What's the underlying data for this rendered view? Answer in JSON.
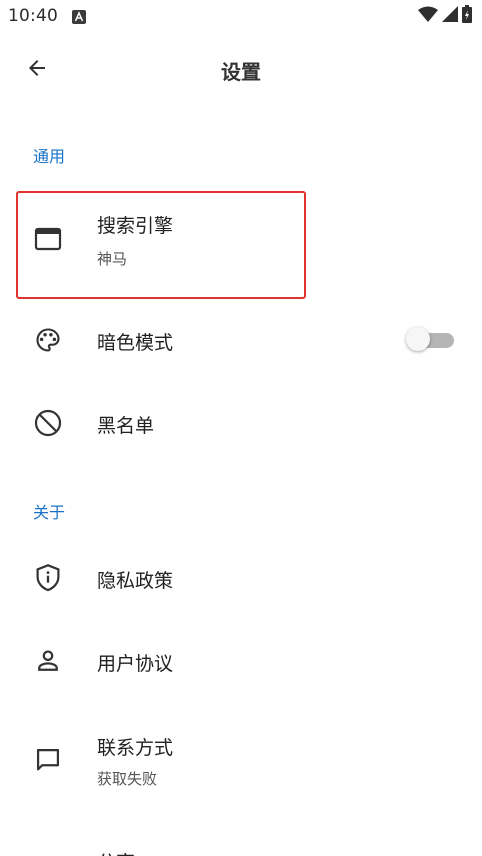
{
  "status_bar": {
    "time": "10:40",
    "icons": [
      "notification-a-icon",
      "wifi-icon",
      "signal-icon",
      "battery-icon"
    ]
  },
  "app_bar": {
    "back_icon": "arrow-back-icon",
    "title": "设置"
  },
  "sections": {
    "general": {
      "header": "通用",
      "items": {
        "search_engine": {
          "title": "搜索引擎",
          "subtitle": "神马",
          "icon": "browser-window-icon"
        },
        "dark_mode": {
          "title": "暗色模式",
          "icon": "palette-icon",
          "toggle_on": false
        },
        "blacklist": {
          "title": "黑名单",
          "icon": "block-icon"
        }
      }
    },
    "about": {
      "header": "关于",
      "items": {
        "privacy_policy": {
          "title": "隐私政策",
          "icon": "shield-info-icon"
        },
        "user_agreement": {
          "title": "用户协议",
          "icon": "person-icon"
        },
        "contact": {
          "title": "联系方式",
          "subtitle": "获取失败",
          "icon": "chat-bubble-icon"
        },
        "partial_item": {
          "title": "分享"
        }
      }
    }
  },
  "colors": {
    "accent": "#1a73c8",
    "highlight": "#e0352f",
    "toggle_track": "#b5b5b5"
  }
}
